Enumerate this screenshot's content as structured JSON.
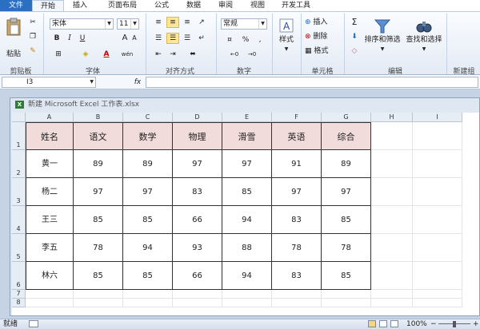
{
  "ribbon_tabs": [
    "文件",
    "开始",
    "插入",
    "页面布局",
    "公式",
    "数据",
    "审阅",
    "视图",
    "开发工具"
  ],
  "active_tab": "开始",
  "clipboard": {
    "paste_label": "粘贴",
    "group_label": "剪贴板"
  },
  "font": {
    "name": "宋体",
    "size": "11",
    "group_label": "字体",
    "bold": "B",
    "italic": "I",
    "underline": "U",
    "grow": "A",
    "shrink": "A",
    "color_letter": "A",
    "phonetic": "wén"
  },
  "alignment": {
    "group_label": "对齐方式"
  },
  "number": {
    "format": "常规",
    "group_label": "数字",
    "percent": "%",
    "comma": ","
  },
  "styles": {
    "label": "样式"
  },
  "cells_group": {
    "insert": "插入",
    "delete": "删除",
    "format": "格式",
    "group_label": "单元格"
  },
  "editing": {
    "sigma": "Σ",
    "sort_filter": "排序和筛选",
    "find_select": "查找和选择",
    "group_label": "编辑"
  },
  "new_group_label": "新建组",
  "formula_bar": {
    "name_box": "I3",
    "fx": "fx",
    "value": ""
  },
  "workbook": {
    "title": "新建 Microsoft Excel 工作表.xlsx",
    "icon_letter": "X"
  },
  "columns": [
    "A",
    "B",
    "C",
    "D",
    "E",
    "F",
    "G",
    "H",
    "I"
  ],
  "rows": [
    "1",
    "2",
    "3",
    "4",
    "5",
    "6",
    "7",
    "8"
  ],
  "table": {
    "headers": [
      "姓名",
      "语文",
      "数学",
      "物理",
      "滑雪",
      "英语",
      "综合"
    ],
    "rows": [
      [
        "黄一",
        "89",
        "89",
        "97",
        "97",
        "91",
        "89"
      ],
      [
        "杨二",
        "97",
        "97",
        "83",
        "85",
        "97",
        "97"
      ],
      [
        "王三",
        "85",
        "85",
        "66",
        "94",
        "83",
        "85"
      ],
      [
        "李五",
        "78",
        "94",
        "93",
        "88",
        "78",
        "78"
      ],
      [
        "林六",
        "85",
        "85",
        "66",
        "94",
        "83",
        "85"
      ]
    ]
  },
  "status": {
    "ready": "就绪",
    "zoom": "100%",
    "minus": "−",
    "plus": "+"
  },
  "colors": {
    "header_fill": "#f2dcdb",
    "file_tab": "#2a6fc0"
  }
}
